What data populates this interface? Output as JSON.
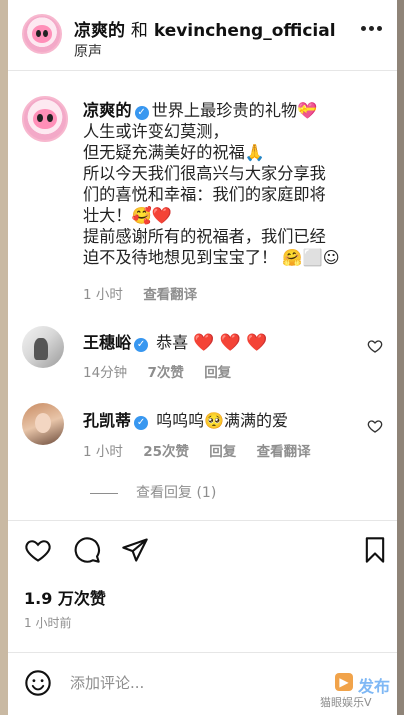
{
  "header": {
    "username": "凉爽的",
    "and_text": "和",
    "collaborator": "kevincheng_official",
    "audio_label": "原声"
  },
  "caption": {
    "username": "凉爽的",
    "lines": [
      "世界上最珍贵的礼物💝",
      "人生或许变幻莫测，",
      "但无疑充满美好的祝福🙏",
      "所以今天我们很高兴与大家分享我",
      "们的喜悦和幸福：我们的家庭即将",
      "壮大！🥰❤️",
      "提前感谢所有的祝福者，我们已经",
      "迫不及待地想见到宝宝了！ 🤗⬜☺"
    ],
    "time": "1 小时",
    "translate": "查看翻译"
  },
  "comments": [
    {
      "username": "王穗峪",
      "text": "恭喜",
      "hearts": "❤️ ❤️ ❤️",
      "time": "14分钟",
      "likes": "7次赞",
      "reply": "回复"
    },
    {
      "username": "孔凯蒂",
      "text": "呜呜呜🥺满满的爱",
      "time": "1 小时",
      "likes": "25次赞",
      "reply": "回复",
      "translate": "查看翻译"
    }
  ],
  "view_replies": "查看回复 (1)",
  "post": {
    "likes": "1.9 万次赞",
    "time": "1 小时前"
  },
  "add_comment": {
    "placeholder": "添加评论...",
    "post_label": "发布"
  },
  "watermark": "猫眼娱乐V",
  "colors": {
    "verified": "#3897f0",
    "heart": "#e0162b",
    "post_button": "#7fb8f5",
    "meta_text": "#8e8e8e"
  },
  "icons": [
    "more-icon",
    "verified-icon",
    "heart-icon",
    "comment-icon",
    "share-icon",
    "bookmark-icon",
    "emoji-icon"
  ]
}
